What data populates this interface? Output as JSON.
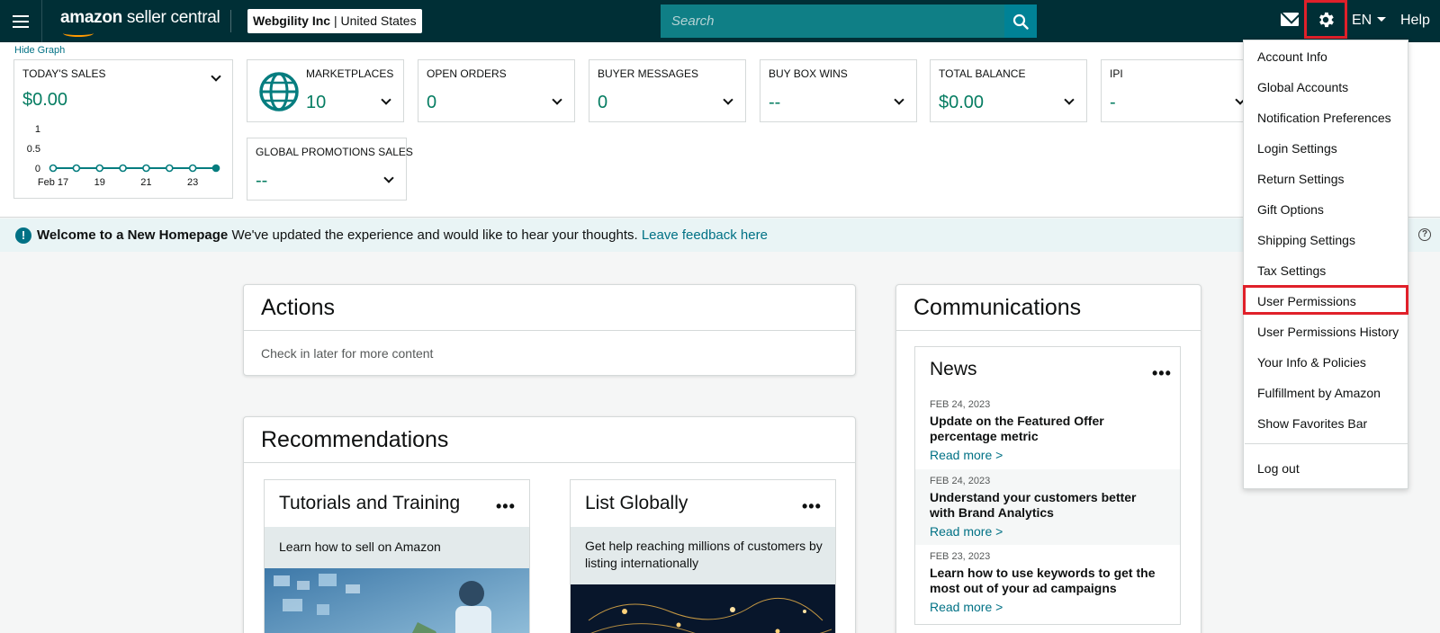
{
  "topnav": {
    "brand_bold": "amazon",
    "brand_light": " seller central",
    "account_name": "Webgility Inc",
    "account_separator": " | ",
    "account_region": "United States",
    "search_placeholder": "Search",
    "lang": "EN",
    "help": "Help"
  },
  "metrics": {
    "hide_graph": "Hide Graph",
    "todays_sales": {
      "title": "TODAY'S SALES",
      "value": "$0.00"
    },
    "cards": [
      {
        "title": "MARKETPLACES",
        "value": "10"
      },
      {
        "title": "OPEN ORDERS",
        "value": "0"
      },
      {
        "title": "BUYER MESSAGES",
        "value": "0"
      },
      {
        "title": "BUY BOX WINS",
        "value": "--"
      },
      {
        "title": "TOTAL BALANCE",
        "value": "$0.00"
      },
      {
        "title": "IPI",
        "value": "-"
      },
      {
        "title": "GLOBAL PROMOTIONS SALES",
        "value": "--"
      }
    ]
  },
  "chart_data": {
    "type": "line",
    "x": [
      "Feb 17",
      "18",
      "19",
      "20",
      "21",
      "22",
      "23",
      "24"
    ],
    "values": [
      0,
      0,
      0,
      0,
      0,
      0,
      0,
      0
    ],
    "x_tick_labels": [
      "Feb 17",
      "19",
      "21",
      "23"
    ],
    "y_tick_labels": [
      "1",
      "0.5",
      "0"
    ],
    "ylim": [
      0,
      1
    ],
    "color": "#067d7f"
  },
  "banner": {
    "title": "Welcome to a New Homepage",
    "text": " We've updated the experience and would like to hear your thoughts. ",
    "link": "Leave feedback here"
  },
  "actions": {
    "title": "Actions",
    "empty": "Check in later for more content"
  },
  "recommendations": {
    "title": "Recommendations",
    "cards": [
      {
        "title": "Tutorials and Training",
        "desc": "Learn how to sell on Amazon"
      },
      {
        "title": "List Globally",
        "desc": "Get help reaching millions of customers by listing internationally"
      }
    ]
  },
  "communications": {
    "title": "Communications",
    "news_title": "News",
    "items": [
      {
        "date": "FEB 24, 2023",
        "headline": "Update on the Featured Offer percentage metric",
        "link": "Read more >"
      },
      {
        "date": "FEB 24, 2023",
        "headline": "Understand your customers better with Brand Analytics",
        "link": "Read more >"
      },
      {
        "date": "FEB 23, 2023",
        "headline": "Learn how to use keywords to get the most out of your ad campaigns",
        "link": "Read more >"
      }
    ]
  },
  "settings_menu": {
    "items": [
      "Account Info",
      "Global Accounts",
      "Notification Preferences",
      "Login Settings",
      "Return Settings",
      "Gift Options",
      "Shipping Settings",
      "Tax Settings",
      "User Permissions",
      "User Permissions History",
      "Your Info & Policies",
      "Fulfillment by Amazon",
      "Show Favorites Bar"
    ],
    "logout": "Log out"
  },
  "colors": {
    "nav_bg": "#002f36",
    "accent_teal": "#067d62",
    "link": "#007185",
    "highlight_red": "#e0202a"
  }
}
